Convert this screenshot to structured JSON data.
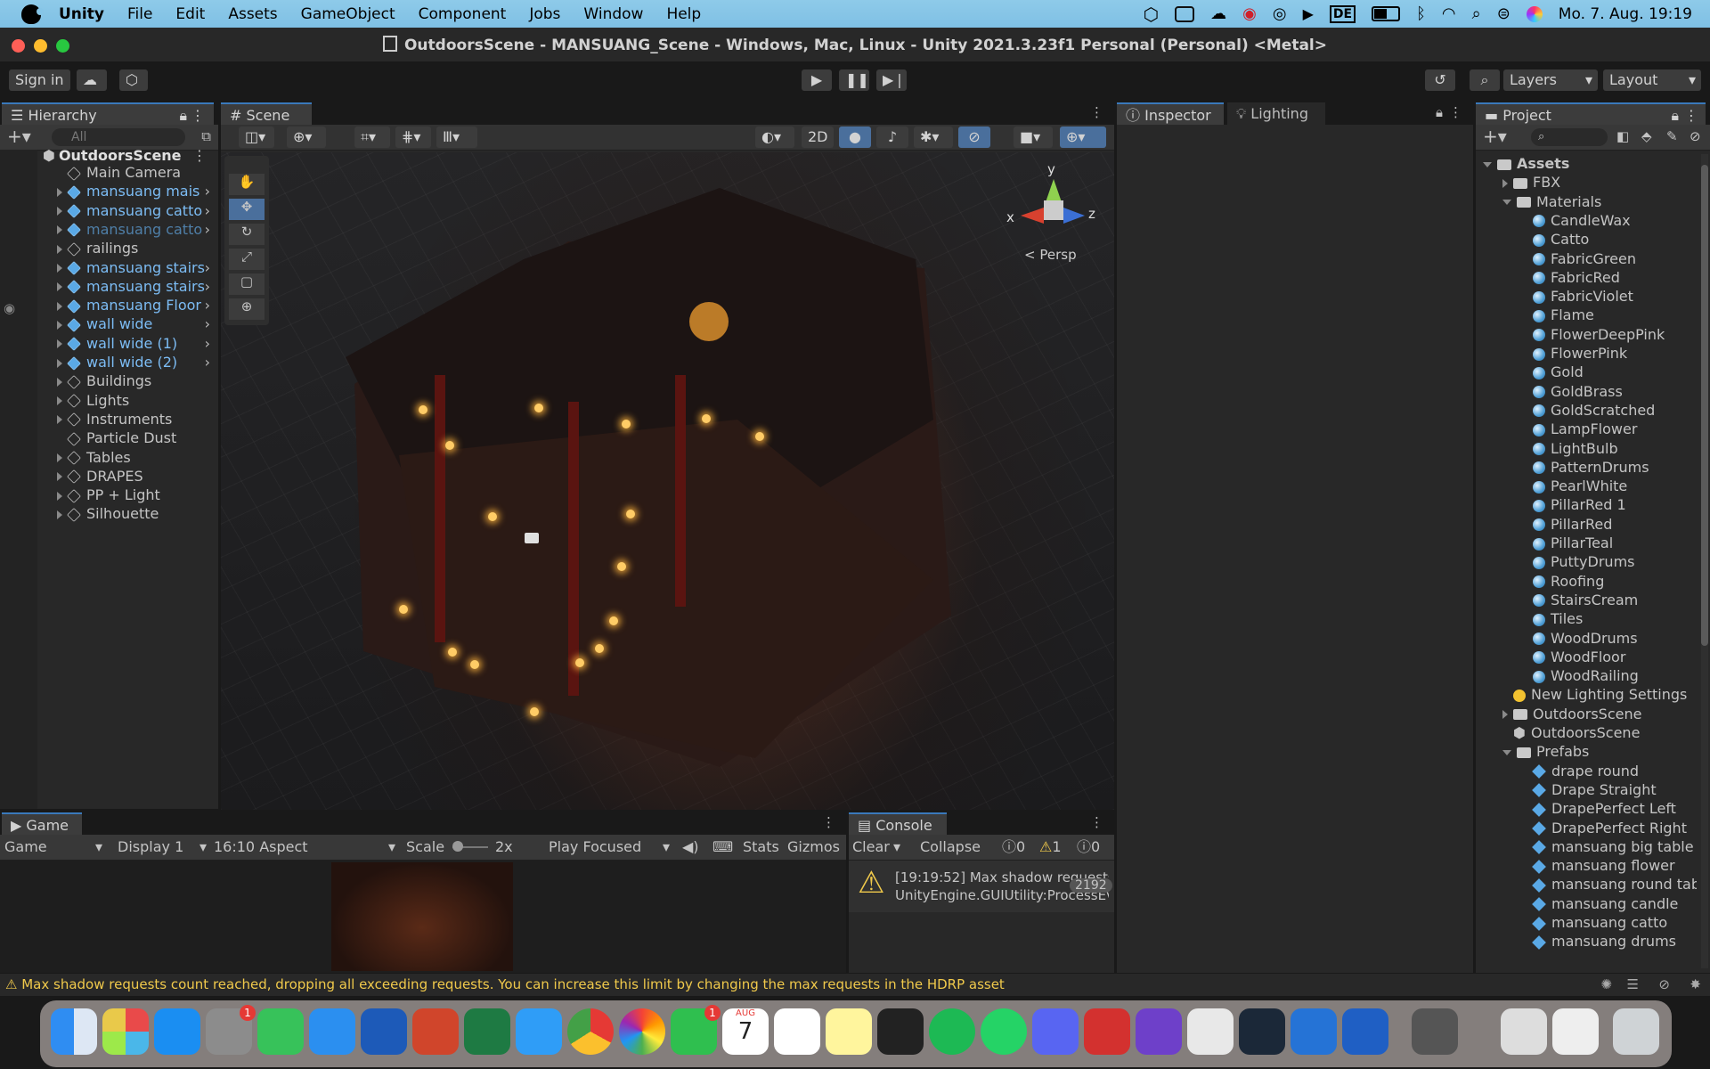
{
  "menubar": {
    "app": "Unity",
    "items": [
      "File",
      "Edit",
      "Assets",
      "GameObject",
      "Component",
      "Jobs",
      "Window",
      "Help"
    ],
    "clock": "Mo. 7. Aug.  19:19"
  },
  "window": {
    "title": "OutdoorsScene - MANSUANG_Scene - Windows, Mac, Linux - Unity 2021.3.23f1 Personal (Personal) <Metal>"
  },
  "toolbar": {
    "sign_in": "Sign in",
    "layers": "Layers",
    "layout": "Layout"
  },
  "hierarchy": {
    "tab": "Hierarchy",
    "search_placeholder": "All",
    "scene": "OutdoorsScene",
    "items": [
      {
        "label": "Main Camera",
        "style": "plain",
        "expand": false
      },
      {
        "label": "mansuang mais",
        "style": "blue",
        "expand": true
      },
      {
        "label": "mansuang catto",
        "style": "blue",
        "expand": true
      },
      {
        "label": "mansuang catto",
        "style": "dim",
        "expand": true
      },
      {
        "label": "railings",
        "style": "plain",
        "expand": true
      },
      {
        "label": "mansuang stairs",
        "style": "blue",
        "expand": true
      },
      {
        "label": "mansuang stairs",
        "style": "blue",
        "expand": true
      },
      {
        "label": "mansuang Floor",
        "style": "blue",
        "expand": true
      },
      {
        "label": "wall wide",
        "style": "blue",
        "expand": true
      },
      {
        "label": "wall wide (1)",
        "style": "blue",
        "expand": true
      },
      {
        "label": "wall wide (2)",
        "style": "blue",
        "expand": true
      },
      {
        "label": "Buildings",
        "style": "plain",
        "expand": true
      },
      {
        "label": "Lights",
        "style": "plain",
        "expand": true
      },
      {
        "label": "Instruments",
        "style": "plain",
        "expand": true
      },
      {
        "label": "Particle Dust",
        "style": "plain",
        "expand": false
      },
      {
        "label": "Tables",
        "style": "plain",
        "expand": true
      },
      {
        "label": "DRAPES",
        "style": "plain",
        "expand": true
      },
      {
        "label": "PP + Light",
        "style": "plain",
        "expand": true
      },
      {
        "label": "Silhouette",
        "style": "plain",
        "expand": true
      }
    ]
  },
  "scene": {
    "tab": "Scene",
    "btn_2d": "2D",
    "persp": "Persp",
    "axis_x": "x",
    "axis_y": "y",
    "axis_z": "z"
  },
  "inspector": {
    "tab_inspector": "Inspector",
    "tab_lighting": "Lighting"
  },
  "project": {
    "tab": "Project",
    "items": [
      {
        "label": "Assets",
        "type": "folder-open",
        "indent": 0,
        "bold": true
      },
      {
        "label": "FBX",
        "type": "folder",
        "indent": 1
      },
      {
        "label": "Materials",
        "type": "folder-open",
        "indent": 1
      },
      {
        "label": "CandleWax",
        "type": "mat",
        "indent": 2
      },
      {
        "label": "Catto",
        "type": "mat",
        "indent": 2
      },
      {
        "label": "FabricGreen",
        "type": "mat",
        "indent": 2
      },
      {
        "label": "FabricRed",
        "type": "mat",
        "indent": 2
      },
      {
        "label": "FabricViolet",
        "type": "mat",
        "indent": 2
      },
      {
        "label": "Flame",
        "type": "mat",
        "indent": 2
      },
      {
        "label": "FlowerDeepPink",
        "type": "mat",
        "indent": 2
      },
      {
        "label": "FlowerPink",
        "type": "mat",
        "indent": 2
      },
      {
        "label": "Gold",
        "type": "mat",
        "indent": 2
      },
      {
        "label": "GoldBrass",
        "type": "mat",
        "indent": 2
      },
      {
        "label": "GoldScratched",
        "type": "mat",
        "indent": 2
      },
      {
        "label": "LampFlower",
        "type": "mat",
        "indent": 2
      },
      {
        "label": "LightBulb",
        "type": "mat",
        "indent": 2
      },
      {
        "label": "PatternDrums",
        "type": "mat",
        "indent": 2
      },
      {
        "label": "PearlWhite",
        "type": "mat",
        "indent": 2
      },
      {
        "label": "PillarRed 1",
        "type": "mat",
        "indent": 2
      },
      {
        "label": "PillarRed",
        "type": "mat",
        "indent": 2
      },
      {
        "label": "PillarTeal",
        "type": "mat",
        "indent": 2
      },
      {
        "label": "PuttyDrums",
        "type": "mat",
        "indent": 2
      },
      {
        "label": "Roofing",
        "type": "mat",
        "indent": 2
      },
      {
        "label": "StairsCream",
        "type": "mat",
        "indent": 2
      },
      {
        "label": "Tiles",
        "type": "mat",
        "indent": 2
      },
      {
        "label": "WoodDrums",
        "type": "mat",
        "indent": 2
      },
      {
        "label": "WoodFloor",
        "type": "mat",
        "indent": 2
      },
      {
        "label": "WoodRailing",
        "type": "mat",
        "indent": 2
      },
      {
        "label": "New Lighting Settings",
        "type": "light",
        "indent": 1
      },
      {
        "label": "OutdoorsScene",
        "type": "folder",
        "indent": 1
      },
      {
        "label": "OutdoorsScene",
        "type": "scene",
        "indent": 1
      },
      {
        "label": "Prefabs",
        "type": "folder-open",
        "indent": 1
      },
      {
        "label": "drape round",
        "type": "prefab",
        "indent": 2
      },
      {
        "label": "Drape Straight",
        "type": "prefab",
        "indent": 2
      },
      {
        "label": "DrapePerfect Left",
        "type": "prefab",
        "indent": 2
      },
      {
        "label": "DrapePerfect Right",
        "type": "prefab",
        "indent": 2
      },
      {
        "label": "mansuang  big table",
        "type": "prefab",
        "indent": 2
      },
      {
        "label": "mansuang  flower",
        "type": "prefab",
        "indent": 2
      },
      {
        "label": "mansuang  round tabl",
        "type": "prefab",
        "indent": 2
      },
      {
        "label": "mansuang candle",
        "type": "prefab",
        "indent": 2
      },
      {
        "label": "mansuang catto",
        "type": "prefab",
        "indent": 2
      },
      {
        "label": "mansuang drums",
        "type": "prefab",
        "indent": 2
      }
    ]
  },
  "game": {
    "tab": "Game",
    "mode": "Game",
    "display": "Display 1",
    "aspect": "16:10 Aspect",
    "scale_label": "Scale",
    "scale_value": "2x",
    "play_mode": "Play Focused",
    "stats": "Stats",
    "gizmos": "Gizmos"
  },
  "console": {
    "tab": "Console",
    "clear": "Clear",
    "collapse": "Collapse",
    "count_info": "0",
    "count_warn": "1",
    "count_error": "0",
    "msg_line1": "[19:19:52] Max shadow requests",
    "msg_line2": "UnityEngine.GUIUtility:ProcessEv",
    "msg_count": "2192"
  },
  "status": {
    "message": "Max shadow requests count reached, dropping all exceeding requests. You can increase this limit by changing the max requests in the HDRP asset"
  },
  "dock": {
    "calendar_month": "AUG",
    "calendar_day": "7",
    "badge_settings": "1",
    "badge_facetime": "1"
  },
  "colors": {
    "accent": "#3a79bb",
    "warning": "#f0c94b",
    "panel": "#282828",
    "menubar": "#86c5e7"
  }
}
